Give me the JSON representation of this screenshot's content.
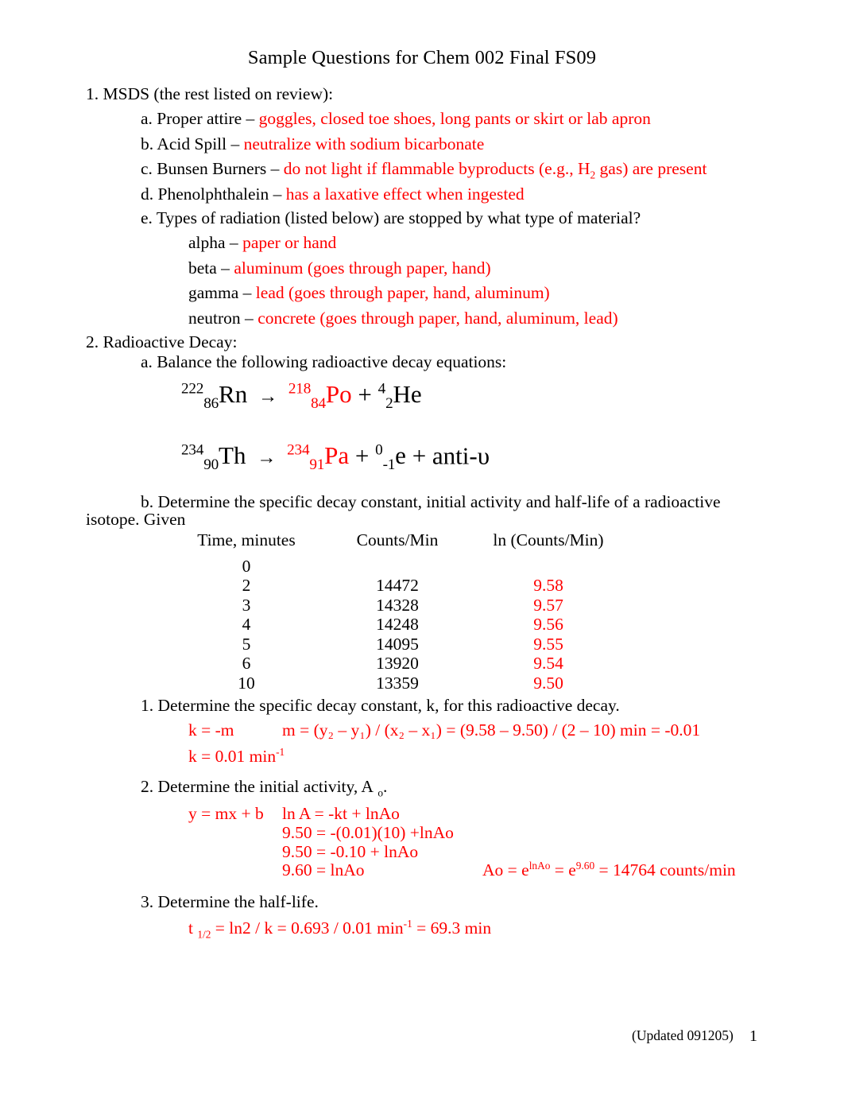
{
  "document": {
    "title": "Sample Questions for Chem 002 Final FS09",
    "footer_note": "(Updated 091205)",
    "page_number": "1",
    "answer_color": "#ff0000",
    "text_color": "#000000"
  },
  "q1": {
    "heading": "1. MSDS (the rest listed on review):",
    "items": [
      {
        "prompt": "a. Proper attire –",
        "answer": "goggles, closed toe shoes, long pants or skirt or lab apron"
      },
      {
        "prompt": "b. Acid Spill –",
        "answer": "neutralize with sodium bicarbonate"
      },
      {
        "prompt": "c. Bunsen Burners –",
        "answer_pre": "do not light if flammable byproducts (e.g., H",
        "answer_sub": "2",
        "answer_post": " gas) are present"
      },
      {
        "prompt": "d. Phenolphthalein –",
        "answer": "has a laxative effect when ingested"
      }
    ],
    "radiation": {
      "prompt": "e. Types of radiation (listed below) are stopped by what type of material?",
      "rows": [
        {
          "label": "alpha –",
          "answer": "paper or hand"
        },
        {
          "label": "beta –",
          "answer": "aluminum (goes through paper, hand)"
        },
        {
          "label": "gamma –",
          "answer": "lead (goes through paper, hand, aluminum)"
        },
        {
          "label": "neutron –",
          "answer": "concrete (goes through paper, hand, aluminum, lead)"
        }
      ]
    }
  },
  "q2": {
    "heading": "2. Radioactive Decay:",
    "part_a": {
      "prompt": "a. Balance the following radioactive decay equations:",
      "equations": [
        {
          "reactant": {
            "mass": "222",
            "atomic": "86",
            "symbol": "Rn"
          },
          "arrow": "→",
          "product1": {
            "mass": "218",
            "atomic": "84",
            "symbol": "Po",
            "color": "red"
          },
          "plus": "+",
          "product2": {
            "mass": "4",
            "atomic": "2",
            "symbol": "He"
          }
        },
        {
          "reactant": {
            "mass": "234",
            "atomic": "90",
            "symbol": "Th"
          },
          "arrow": "→",
          "product1": {
            "mass": "234",
            "atomic": "91",
            "symbol": "Pa",
            "color": "red"
          },
          "plus": "+",
          "product2": {
            "mass": "0",
            "atomic": "-1",
            "symbol": "e"
          },
          "plus2": "+",
          "product3": "anti-υ"
        }
      ]
    },
    "part_b": {
      "prompt_line1": "b. Determine the specific decay constant, initial activity and half-life of a radioactive",
      "prompt_line2": "isotope. Given",
      "table": {
        "headers": [
          "Time, minutes",
          "Counts/Min",
          "ln (Counts/Min)"
        ],
        "rows": [
          {
            "time": "0",
            "counts": "",
            "ln": ""
          },
          {
            "time": "2",
            "counts": "14472",
            "ln": "9.58"
          },
          {
            "time": "3",
            "counts": "14328",
            "ln": "9.57"
          },
          {
            "time": "4",
            "counts": "14248",
            "ln": "9.56"
          },
          {
            "time": "5",
            "counts": "14095",
            "ln": "9.55"
          },
          {
            "time": "6",
            "counts": "13920",
            "ln": "9.54"
          },
          {
            "time": "10",
            "counts": "13359",
            "ln": "9.50"
          }
        ]
      },
      "sub1": {
        "prompt": "1. Determine the specific decay constant, k, for this radioactive decay.",
        "answer_left": "k = -m",
        "answer_m_pre": "m = (y",
        "answer_m": "m = (y₂ – y₁) / (x₂ – x₁) = (9.58 – 9.50) / (2 – 10) min = -0.01",
        "answer_k_pre": "k = 0.01 min",
        "answer_k_sup": "-1"
      },
      "sub2": {
        "prompt_pre": "2. Determine the initial activity, A",
        "prompt_sub": "o",
        "prompt_post": ".",
        "answer_left": "y = mx + b",
        "lines": [
          "ln A = -kt + lnAo",
          "9.50 = -(0.01)(10) +lnAo",
          "9.50 = -0.10 + lnAo",
          "9.60 = lnAo"
        ],
        "right_pre": "Ao = e",
        "right_sup1": "lnAo",
        "right_mid": " = e",
        "right_sup2": "9.60",
        "right_post": " = 14764 counts/min"
      },
      "sub3": {
        "prompt": "3. Determine the half-life.",
        "answer_pre": "t ",
        "answer_sub": "1/2",
        "answer_mid": " = ln2 / k = 0.693 / 0.01 min",
        "answer_sup": "-1",
        "answer_post": " = 69.3 min"
      }
    }
  }
}
